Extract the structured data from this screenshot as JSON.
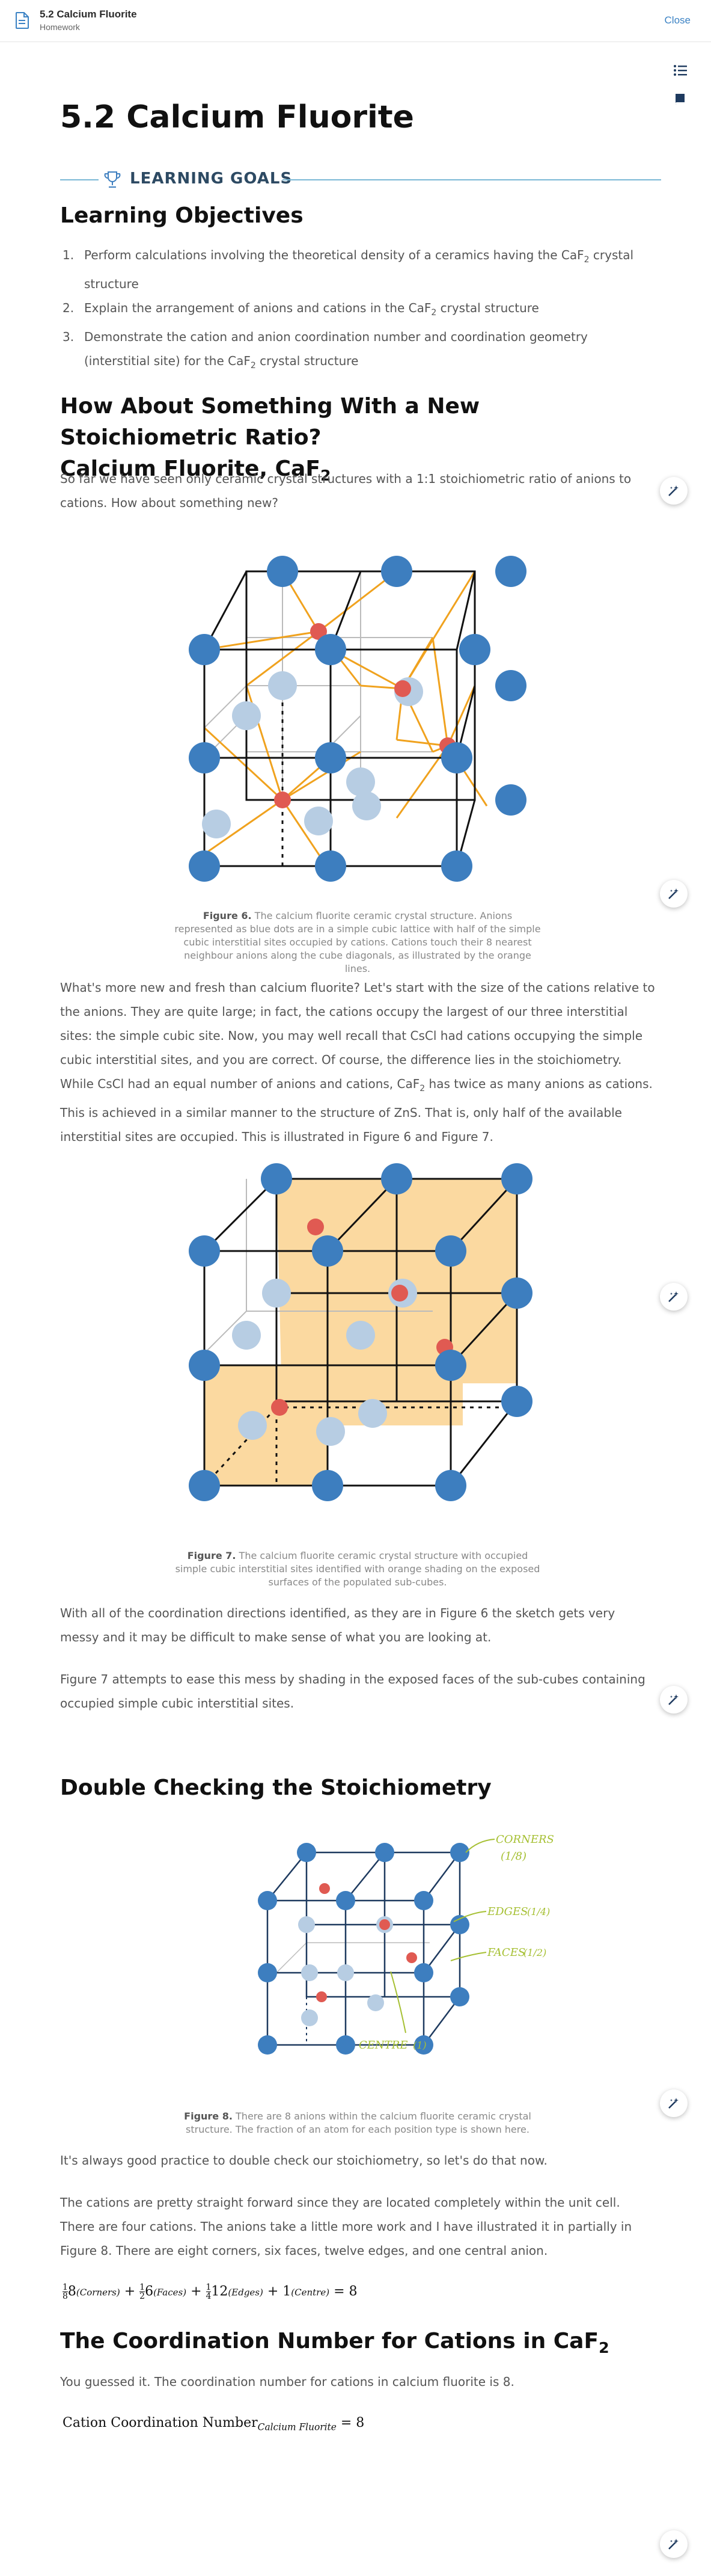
{
  "topbar": {
    "title": "5.2 Calcium Fluorite",
    "subtitle": "Homework",
    "close_label": "Close"
  },
  "page": {
    "title": "5.2 Calcium Fluorite"
  },
  "goals": {
    "label": "LEARNING GOALS"
  },
  "objectives": {
    "heading": "Learning Objectives",
    "items": [
      {
        "num": "1.",
        "before": "Perform calculations involving the theoretical density of a ceramics having the CaF",
        "sub": "2",
        "after": " crystal structure"
      },
      {
        "num": "2.",
        "before": "Explain the arrangement of anions and cations in the CaF",
        "sub": "2",
        "after": " crystal structure"
      },
      {
        "num": "3.",
        "before": "Demonstrate the cation and anion coordination number and coordination geometry (interstitial site) for the CaF",
        "sub": "2",
        "after": " crystal structure"
      }
    ]
  },
  "section1": {
    "heading_line1": "How About Something With a New Stoichiometric Ratio?",
    "heading_line2": " Calcium Fluorite, CaF",
    "heading_sub": "2",
    "intro": "So far we have seen only ceramic crystal structures with a 1:1 stoichiometric ratio of anions to cations.  How about something new?",
    "fig6_label": "Figure 6.",
    "fig6_caption": " The calcium fluorite ceramic crystal structure. Anions represented as blue dots are in a simple cubic lattice with half of the simple cubic interstitial sites occupied by cations. Cations touch their 8 nearest neighbour anions along the cube diagonals, as illustrated by the orange lines.",
    "para1_a": "What's more new and fresh than calcium fluorite?  Let's start with the size of the cations relative to the anions.  They are quite large; in fact, the cations occupy the largest of our three interstitial sites: the simple cubic site.  Now, you may well recall that CsCl had cations occupying the simple cubic interstitial sites, and you are correct.  Of course, the difference lies in the stoichiometry.  While CsCl had an equal number of anions and cations, CaF",
    "para1_sub": "2",
    "para1_b": " has twice as many anions as cations.  This is achieved in a similar manner to the structure of ZnS.  That is, only half of the available interstitial sites are occupied.  This is illustrated in Figure 6 and Figure 7.",
    "fig7_label": "Figure 7.",
    "fig7_caption": " The calcium fluorite ceramic crystal structure with occupied simple cubic interstitial sites identified with orange shading on the exposed surfaces of the populated sub-cubes.",
    "para2": "With all of the coordination directions identified, as they are in Figure 6 the sketch gets very messy and it may be difficult to make sense of what you are looking at.",
    "para3": "Figure 7 attempts to ease this mess by shading in the exposed faces of the sub-cubes containing occupied simple cubic interstitial sites."
  },
  "section2": {
    "heading": "Double Checking the Stoichiometry",
    "annotations": {
      "corners": "CORNERS",
      "corners_frac": "(1/8)",
      "edges": "EDGES",
      "edges_frac": "(1/4)",
      "faces": "FACES",
      "faces_frac": "(1/2)",
      "centre": "CENTRE",
      "centre_frac": "(1)"
    },
    "fig8_label": "Figure 8.",
    "fig8_caption": " There are 8 anions within the calcium fluorite ceramic crystal structure. The fraction of an atom for each position type is shown here.",
    "para1": "It's always good practice to double check our stoichiometry, so let's do that now.",
    "para2": "The cations are pretty straight forward since they are located completely within the unit cell.  There are four cations.  The anions take a little more work and I have illustrated it in partially in Figure 8.  There are eight corners, six faces, twelve edges, and one central anion.",
    "eq": {
      "t1": "8",
      "s1": "(Corners)",
      "t2": "6",
      "s2": "(Faces)",
      "t3": "12",
      "s3": "(Edges)",
      "t4": "1",
      "s4": "(Centre)",
      "result": "= 8"
    }
  },
  "section3": {
    "heading": "The Coordination Number for Cations in CaF",
    "heading_sub": "2",
    "para": "You guessed it.  The coordination number for cations in calcium fluorite is 8.",
    "eq_text": "Cation Coordination Number",
    "eq_sub": "Calcium Fluorite",
    "eq_result": " = 8"
  },
  "colors": {
    "anion": "#3d7ebf",
    "cation": "#e05a52",
    "bond": "#f0a21e",
    "shade": "#fbd9a0",
    "accent": "#3b82c4",
    "annotation": "#a6c033"
  },
  "icons": [
    "document-icon",
    "list-icon",
    "book-icon",
    "wand-icon",
    "trophy-icon"
  ]
}
